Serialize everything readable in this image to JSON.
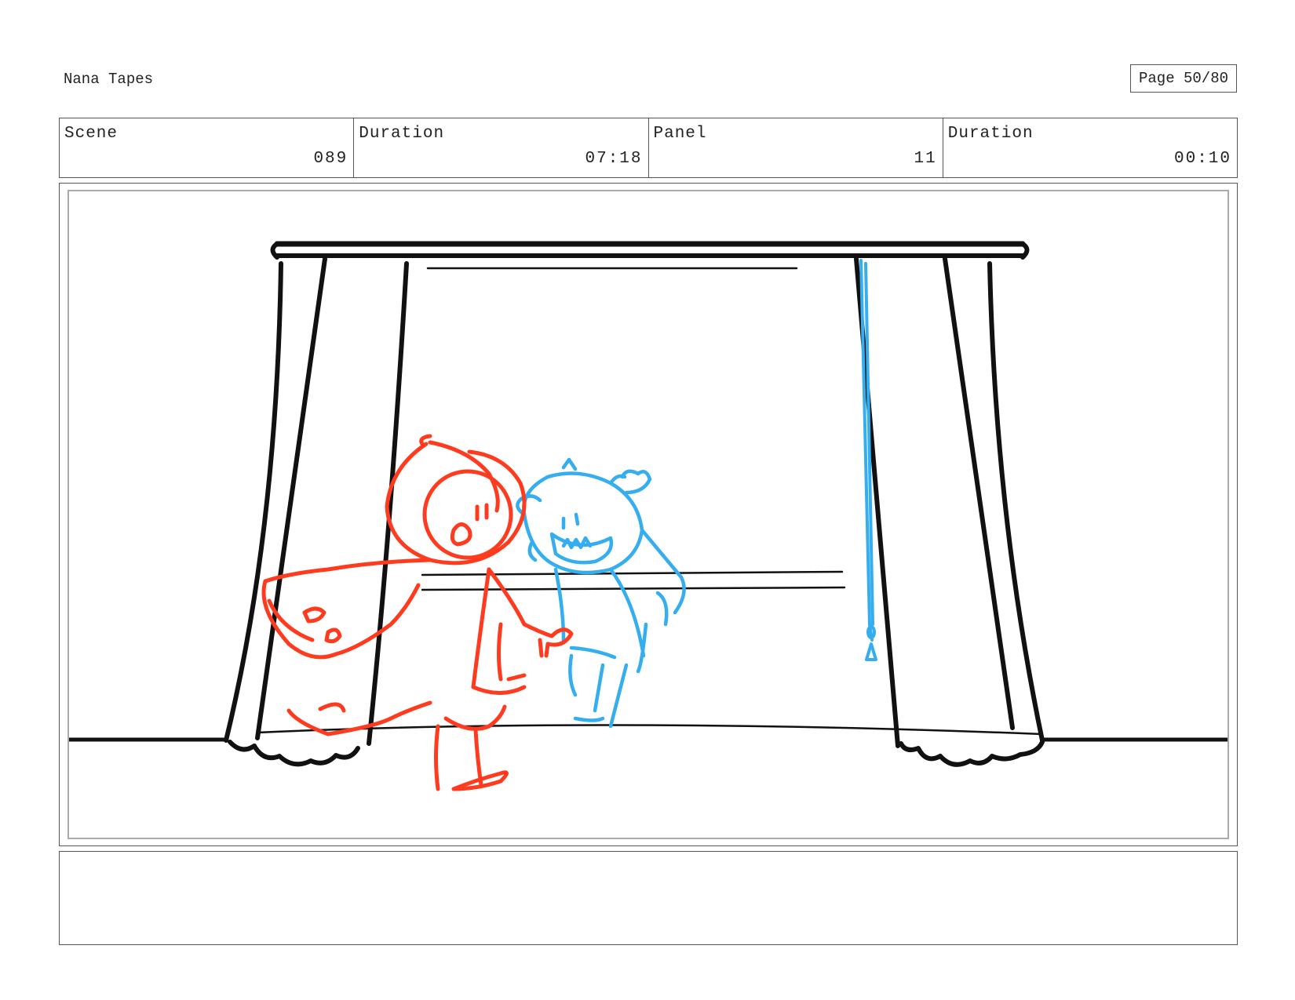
{
  "header": {
    "project_title": "Nana Tapes",
    "page_label": "Page 50/80"
  },
  "info": {
    "scene_label": "Scene",
    "scene_value": "089",
    "scene_duration_label": "Duration",
    "scene_duration_value": "07:18",
    "panel_label": "Panel",
    "panel_value": "11",
    "panel_duration_label": "Duration",
    "panel_duration_value": "00:10"
  },
  "drawing": {
    "colors": {
      "ink": "#111111",
      "red_character": "#ff3b1f",
      "blue_character": "#35aef0"
    },
    "elements": [
      "stage-curtain",
      "red-hooded-puppet",
      "blue-wolf-puppet",
      "curtain-pull-cord",
      "stage-floor"
    ]
  },
  "notes": {
    "text": ""
  }
}
